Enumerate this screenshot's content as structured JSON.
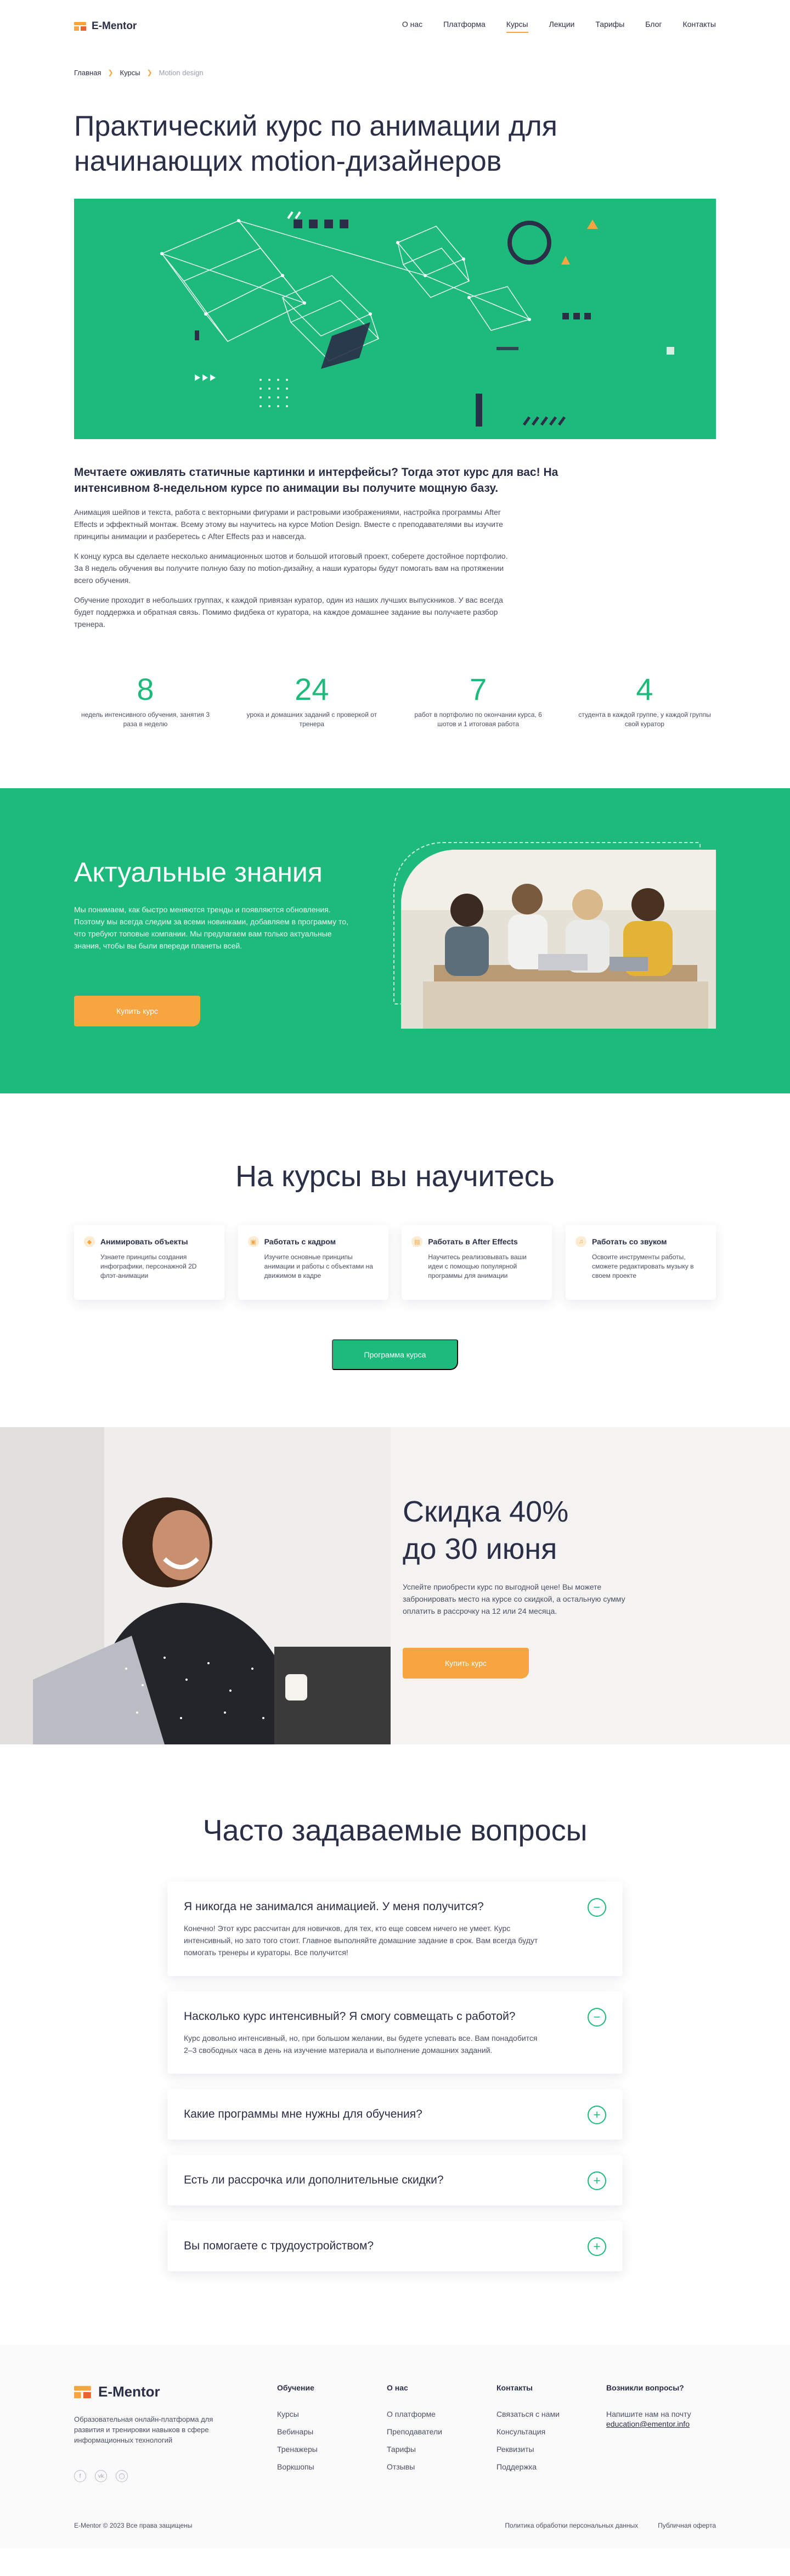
{
  "header": {
    "logo": "E-Mentor",
    "nav": [
      "О нас",
      "Платформа",
      "Курсы",
      "Лекции",
      "Тарифы",
      "Блог",
      "Контакты"
    ],
    "active_nav": "Курсы"
  },
  "breadcrumb": [
    "Главная",
    "Курсы",
    "Motion design"
  ],
  "page_title": "Практический курс по анимации для начинающих motion-дизайнеров",
  "intro": {
    "lead": "Мечтаете оживлять статичные картинки и интерфейсы? Тогда этот курс для вас! На интенсивном 8-недельном курсе по анимации вы получите мощную базу.",
    "paragraphs": [
      "Анимация шейпов и текста, работа с векторными фигурами и растровыми изображениями, настройка программы After Effects и эффектный монтаж. Всему этому вы научитесь на курсе Motion Design. Вместе с преподавателями вы изучите принципы анимации и разберетесь с After Effects раз и навсегда.",
      "К концу курса вы сделаете несколько анимационных шотов и большой итоговый проект, соберете достойное портфолио. За 8 недель обучения вы получите полную базу по motion-дизайну, а наши кураторы будут помогать вам на протяжении всего обучения.",
      "Обучение проходит в небольших группах, к каждой привязан куратор, один из наших лучших выпускников. У вас всегда будет поддержка и обратная связь. Помимо фидбека от куратора, на каждое домашнее задание вы получаете разбор тренера."
    ]
  },
  "stats": [
    {
      "num": "8",
      "desc": "недель интенсивного обучения, занятия 3 раза в неделю"
    },
    {
      "num": "24",
      "desc": "урока и домашних заданий с проверкой от тренера"
    },
    {
      "num": "7",
      "desc": "работ в портфолио по окончании курса, 6 шотов и 1 итоговая работа"
    },
    {
      "num": "4",
      "desc": "студента в каждой группе, у каждой группы свой куратор"
    }
  ],
  "knowledge": {
    "title": "Актуальные знания",
    "text": "Мы понимаем, как быстро меняются тренды и появляются обновления. Поэтому мы всегда следим за всеми новинками, добавляем в программу то, что требуют топовые компании. Мы предлагаем вам только актуальные знания, чтобы вы были впереди планеты всей.",
    "button": "Купить курс"
  },
  "learn": {
    "title": "На курсы вы научитесь",
    "cards": [
      {
        "title": "Анимировать объекты",
        "text": "Узнаете принципы создания инфографики, персонажной 2D флэт-анимации",
        "icon": "shapes-icon"
      },
      {
        "title": "Работать с кадром",
        "text": "Изучите основные принципы анимации и работы с объектами на движимом в кадре",
        "icon": "frame-icon"
      },
      {
        "title": "Работать в After Effects",
        "text": "Научитесь реализовывать ваши идеи с помощью популярной программы для анимации",
        "icon": "layers-icon"
      },
      {
        "title": "Работать со звуком",
        "text": "Освоите инструменты работы, сможете редактировать музыку в своем проекте",
        "icon": "audio-icon"
      }
    ],
    "button": "Программа курса"
  },
  "discount": {
    "title_line1": "Скидка 40%",
    "title_line2": "до 30 июня",
    "text": "Успейте приобрести курс по выгодной цене! Вы можете забронировать место на курсе со скидкой, а остальную сумму оплатить в рассрочку на 12 или 24 месяца.",
    "button": "Купить курс"
  },
  "faq": {
    "title": "Часто задаваемые вопросы",
    "items": [
      {
        "q": "Я никогда не занимался анимацией. У меня получится?",
        "a": "Конечно! Этот курс рассчитан для новичков, для тех, кто еще совсем ничего не умеет. Курс интенсивный, но зато того стоит. Главное выполняйте домашние задание в срок. Вам всегда будут помогать тренеры и кураторы. Все получится!",
        "open": true
      },
      {
        "q": "Насколько курс интенсивный? Я смогу совмещать с работой?",
        "a": "Курс довольно интенсивный, но, при большом желании, вы будете успевать все. Вам понадобится 2–3 свободных часа в день на изучение материала и выполнение домашних заданий.",
        "open": true
      },
      {
        "q": "Какие программы мне нужны для обучения?",
        "a": "",
        "open": false
      },
      {
        "q": "Есть ли рассрочка или дополнительные скидки?",
        "a": "",
        "open": false
      },
      {
        "q": "Вы помогаете с трудоустройством?",
        "a": "",
        "open": false
      }
    ]
  },
  "footer": {
    "logo": "E-Mentor",
    "tagline": "Образовательная онлайн-платформа для развития и тренировки навыков в сфере информационных технологий",
    "social": [
      "facebook-icon",
      "vk-icon",
      "instagram-icon"
    ],
    "columns": [
      {
        "title": "Обучение",
        "links": [
          "Курсы",
          "Вебинары",
          "Тренажеры",
          "Воркшопы"
        ]
      },
      {
        "title": "О нас",
        "links": [
          "О платформе",
          "Преподаватели",
          "Тарифы",
          "Отзывы"
        ]
      },
      {
        "title": "Контакты",
        "links": [
          "Связаться с нами",
          "Консультация",
          "Реквизиты",
          "Поддержка"
        ]
      }
    ],
    "questions": {
      "title": "Возникли вопросы?",
      "text": "Напишите нам на почту",
      "email": "education@ementor.info"
    },
    "copyright": "E-Mentor © 2023 Все права защищены",
    "policy": "Политика обработки персональных данных",
    "offer": "Публичная оферта"
  },
  "colors": {
    "green": "#1dba7c",
    "orange": "#f7a541",
    "dark": "#2a2e47"
  }
}
